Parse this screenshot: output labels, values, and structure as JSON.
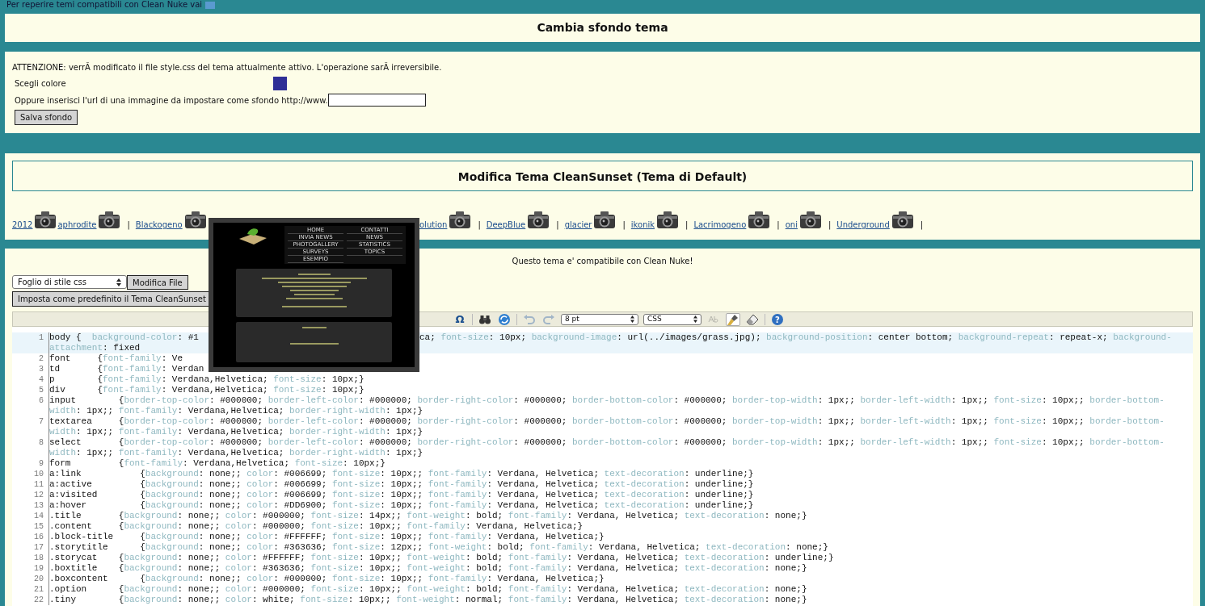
{
  "top_note": {
    "text": "Per reperire temi compatibili con Clean Nuke vai"
  },
  "background_panel": {
    "title": "Cambia sfondo tema",
    "warning": "ATTENZIONE: verrÃ  modificato il file style.css del tema attualmente attivo. L'operazione sarÃ  irreversibile.",
    "color_label": "Scegli colore",
    "color": "#2e2e96",
    "url_label": "Oppure inserisci l'url di una immagine da impostare come sfondo http://www.",
    "save_button": "Salva sfondo"
  },
  "theme_panel": {
    "title": "Modifica Tema CleanSunset (Tema di Default)",
    "themes_before_preview": [
      {
        "kind": "link",
        "label": "2012"
      },
      {
        "kind": "link",
        "label": "aphrodite"
      },
      {
        "kind": "separator",
        "label": "|"
      },
      {
        "kind": "link",
        "label": "Blackogeno"
      }
    ],
    "themes_after_preview": [
      {
        "kind": "link",
        "label": "olution"
      },
      {
        "kind": "separator",
        "label": "|"
      },
      {
        "kind": "link",
        "label": "DeepBlue"
      },
      {
        "kind": "separator",
        "label": "|"
      },
      {
        "kind": "link",
        "label": "glacier"
      },
      {
        "kind": "separator",
        "label": "|"
      },
      {
        "kind": "link",
        "label": "ikonik"
      },
      {
        "kind": "separator",
        "label": "|"
      },
      {
        "kind": "link",
        "label": "Lacrimogeno"
      },
      {
        "kind": "separator",
        "label": "|"
      },
      {
        "kind": "link",
        "label": "oni"
      },
      {
        "kind": "separator",
        "label": "|"
      },
      {
        "kind": "link",
        "label": "Underground"
      },
      {
        "kind": "separator",
        "label": "|"
      }
    ]
  },
  "preview": {
    "menu": [
      "HOME",
      "CONTATTI",
      "INVIA NEWS",
      "NEWS",
      "PHOTOGALLERY",
      "STATISTICS",
      "SURVEYS",
      "TOPICS",
      "ESEMPIO"
    ]
  },
  "editor_panel": {
    "compat_note": "Questo tema e' compatibile con Clean Nuke!",
    "file_select": "Foglio di stile css",
    "edit_button": "Modifica File",
    "default_button": "Imposta come predefinito il Tema CleanSunset",
    "toolbar": [
      {
        "kind": "omega",
        "glyph": "Ω",
        "disabled": false,
        "pressed": false
      },
      {
        "kind": "sep"
      },
      {
        "kind": "find",
        "disabled": false,
        "pressed": false
      },
      {
        "kind": "replace",
        "disabled": false,
        "pressed": false
      },
      {
        "kind": "sep"
      },
      {
        "kind": "undo",
        "disabled": true,
        "pressed": false
      },
      {
        "kind": "redo",
        "disabled": true,
        "pressed": false
      },
      {
        "kind": "select",
        "value": "8 pt"
      },
      {
        "kind": "select",
        "value": "CSS"
      },
      {
        "kind": "spell",
        "disabled": true,
        "pressed": false
      },
      {
        "kind": "highlight",
        "disabled": false,
        "pressed": true
      },
      {
        "kind": "erase",
        "disabled": false,
        "pressed": false
      },
      {
        "kind": "sep"
      },
      {
        "kind": "help",
        "glyph": "?",
        "disabled": false,
        "pressed": false
      }
    ],
    "code_lines": [
      {
        "number": "1",
        "current": true,
        "before_preview": "body {  background-color: #1",
        "after_preview": "ca; font-size: 10px; background-image: url(../images/grass.jpg); background-position: center bottom; background-repeat: repeat-x; background-attachment: fixed"
      },
      {
        "number": "2",
        "current": false,
        "before_preview": "font     {font-family: Ve"
      },
      {
        "number": "3",
        "current": false,
        "before_preview": "td       {font-family: Verdan"
      },
      {
        "number": "4",
        "current": false,
        "text": "p        {font-family: Verdana,Helvetica; font-size: 10px;}"
      },
      {
        "number": "5",
        "current": false,
        "text": "div      {font-family: Verdana,Helvetica; font-size: 10px;}"
      },
      {
        "number": "6",
        "current": false,
        "text": "input        {border-top-color: #000000; border-left-color: #000000; border-right-color: #000000; border-bottom-color: #000000; border-top-width: 1px;; border-left-width: 1px;; font-size: 10px;; border-bottom-width: 1px;; font-family: Verdana,Helvetica; border-right-width: 1px;}"
      },
      {
        "number": "7",
        "current": false,
        "text": "textarea     {border-top-color: #000000; border-left-color: #000000; border-right-color: #000000; border-bottom-color: #000000; border-top-width: 1px;; border-left-width: 1px;; font-size: 10px;; border-bottom-width: 1px;; font-family: Verdana,Helvetica; border-right-width: 1px;}"
      },
      {
        "number": "8",
        "current": false,
        "text": "select       {border-top-color: #000000; border-left-color: #000000; border-right-color: #000000; border-bottom-color: #000000; border-top-width: 1px;; border-left-width: 1px;; font-size: 10px;; border-bottom-width: 1px;; font-family: Verdana,Helvetica; border-right-width: 1px;}"
      },
      {
        "number": "9",
        "current": false,
        "text": "form         {font-family: Verdana,Helvetica; font-size: 10px;}"
      },
      {
        "number": "10",
        "current": false,
        "text": "a:link           {background: none;; color: #006699; font-size: 10px;; font-family: Verdana, Helvetica; text-decoration: underline;}"
      },
      {
        "number": "11",
        "current": false,
        "text": "a:active         {background: none;; color: #006699; font-size: 10px;; font-family: Verdana, Helvetica; text-decoration: underline;}"
      },
      {
        "number": "12",
        "current": false,
        "text": "a:visited        {background: none;; color: #006699; font-size: 10px;; font-family: Verdana, Helvetica; text-decoration: underline;}"
      },
      {
        "number": "13",
        "current": false,
        "text": "a:hover          {background: none;; color: #DD6900; font-size: 10px;; font-family: Verdana, Helvetica; text-decoration: underline;}"
      },
      {
        "number": "14",
        "current": false,
        "text": ".title       {background: none;; color: #000000; font-size: 14px;; font-weight: bold; font-family: Verdana, Helvetica; text-decoration: none;}"
      },
      {
        "number": "15",
        "current": false,
        "text": ".content     {background: none;; color: #000000; font-size: 10px;; font-family: Verdana, Helvetica;}"
      },
      {
        "number": "16",
        "current": false,
        "text": ".block-title     {background: none;; color: #FFFFFF; font-size: 10px;; font-family: Verdana, Helvetica;}"
      },
      {
        "number": "17",
        "current": false,
        "text": ".storytitle      {background: none;; color: #363636; font-size: 12px;; font-weight: bold; font-family: Verdana, Helvetica; text-decoration: none;}"
      },
      {
        "number": "18",
        "current": false,
        "text": ".storycat    {background: none;; color: #FFFFFF; font-size: 10px;; font-weight: bold; font-family: Verdana, Helvetica; text-decoration: underline;}"
      },
      {
        "number": "19",
        "current": false,
        "text": ".boxtitle    {background: none;; color: #363636; font-size: 10px;; font-weight: bold; font-family: Verdana, Helvetica; text-decoration: none;}"
      },
      {
        "number": "20",
        "current": false,
        "text": ".boxcontent      {background: none;; color: #000000; font-size: 10px;; font-family: Verdana, Helvetica;}"
      },
      {
        "number": "21",
        "current": false,
        "text": ".option      {background: none;; color: #000000; font-size: 10px;; font-weight: bold; font-family: Verdana, Helvetica; text-decoration: none;}"
      },
      {
        "number": "22",
        "current": false,
        "text": ".tiny        {background: none;; color: white; font-size: 10px;; font-weight: normal; font-family: Verdana, Helvetica; text-decoration: none;}"
      }
    ]
  }
}
